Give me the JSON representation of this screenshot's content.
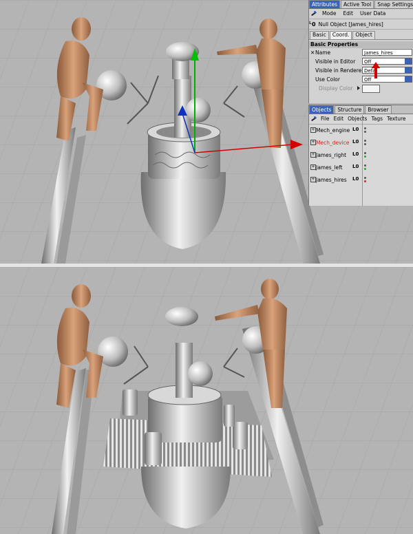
{
  "attributes": {
    "tabs": [
      "Attributes",
      "Active Tool",
      "Snap Settings"
    ],
    "menu": [
      "Mode",
      "Edit",
      "User Data"
    ],
    "object_label": "Null Object [James_hires]",
    "subtabs": [
      "Basic",
      "Coord.",
      "Object"
    ],
    "section": "Basic Properties",
    "props": {
      "name_label": "Name",
      "name_value": "James_hires",
      "visible_editor_label": "Visible in Editor",
      "visible_editor_value": "Off",
      "visible_renderer_label": "Visible in Renderer",
      "visible_renderer_value": "Defa",
      "use_color_label": "Use Color",
      "use_color_value": "Off",
      "display_color_label": "Display Color"
    }
  },
  "objects": {
    "tabs": [
      "Objects",
      "Structure",
      "Browser"
    ],
    "menu": [
      "File",
      "Edit",
      "Objects",
      "Tags",
      "Texture"
    ],
    "items": [
      {
        "name": "Mech_engine",
        "dot2": "#555555"
      },
      {
        "name": "Mech_device",
        "dot2": "#555555",
        "highlight": true
      },
      {
        "name": "James_right",
        "dot2": "#22aa22"
      },
      {
        "name": "James_left",
        "dot2": "#22aa22"
      },
      {
        "name": "James_hires",
        "dot2": "#dd2222"
      }
    ]
  },
  "colors": {
    "accent": "#3a63b5",
    "selected_text": "#dd2222",
    "axis_x": "#d40000",
    "axis_y": "#00b000",
    "axis_z": "#1030c0"
  }
}
